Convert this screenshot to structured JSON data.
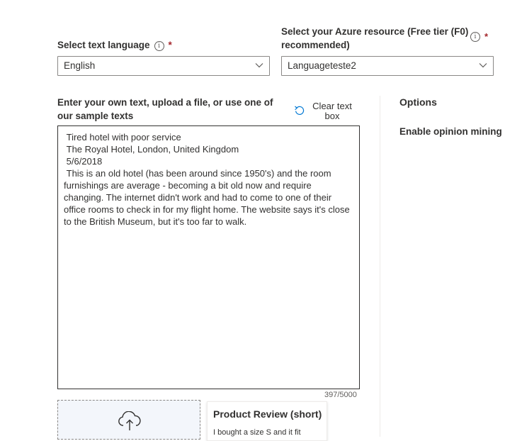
{
  "language": {
    "label": "Select text language",
    "info_icon": "i",
    "required_mark": "*",
    "selected": "English"
  },
  "resource": {
    "label_line1": "Select your Azure resource (Free tier (F0)",
    "label_line2": "recommended)",
    "info_icon": "i",
    "required_mark": "*",
    "selected": "Languageteste2"
  },
  "input": {
    "label_line1": "Enter your own text, upload a file, or use one of",
    "label_line2": "our sample texts",
    "clear_line1": "Clear text",
    "clear_line2": "box",
    "text": " Tired hotel with poor service\n The Royal Hotel, London, United Kingdom\n 5/6/2018\n This is an old hotel (has been around since 1950's) and the room furnishings are average - becoming a bit old now and require changing. The internet didn't work and had to come to one of their office rooms to check in for my flight home. The website says it's close to the British Museum, but it's too far to walk.",
    "counter": "397/5000"
  },
  "options": {
    "title": "Options",
    "opinion_mining": "Enable opinion mining"
  },
  "sample": {
    "title": "Product Review (short)",
    "preview": "I bought a size S and it fit"
  },
  "icons": {
    "info": "info-icon",
    "chevron": "chevron-down-icon",
    "undo": "undo-icon",
    "upload": "cloud-upload-icon"
  }
}
